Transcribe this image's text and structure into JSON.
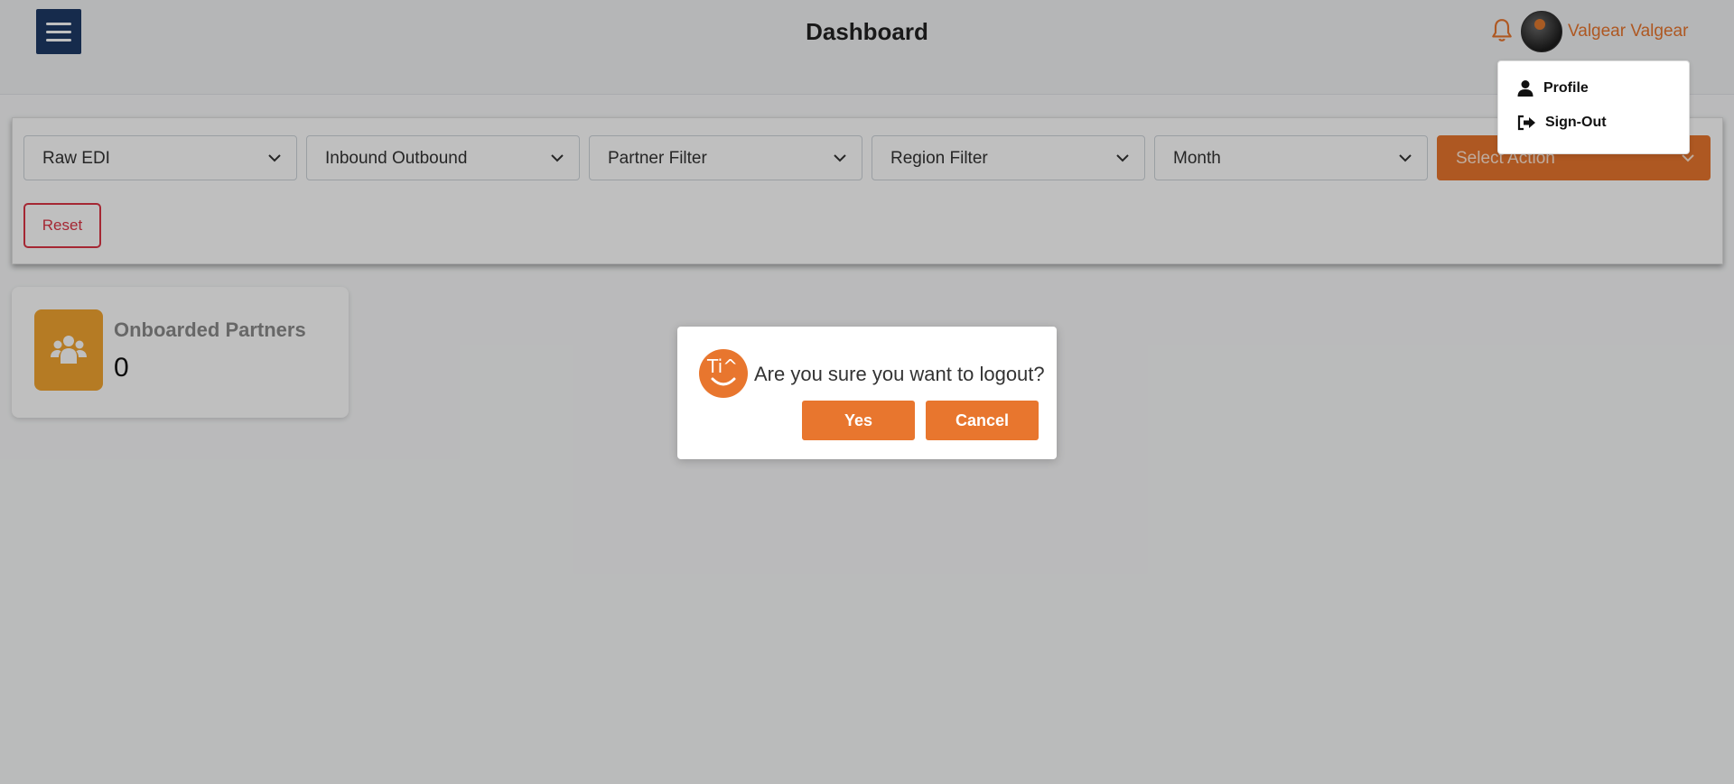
{
  "header": {
    "title": "Dashboard",
    "user_name": "Valgear Valgear"
  },
  "user_menu": {
    "items": [
      {
        "label": "Profile",
        "icon": "user-icon"
      },
      {
        "label": "Sign-Out",
        "icon": "sign-out-icon"
      }
    ]
  },
  "filters": {
    "raw_edi": "Raw EDI",
    "direction": "Inbound Outbound",
    "partner": "Partner Filter",
    "region": "Region Filter",
    "month": "Month",
    "action": "Select Action",
    "reset_label": "Reset"
  },
  "card": {
    "label": "Onboarded Partners",
    "value": "0",
    "icon": "users-icon"
  },
  "modal": {
    "message": "Are you sure you want to logout?",
    "yes_label": "Yes",
    "cancel_label": "Cancel",
    "logo_text": "Ti^"
  },
  "colors": {
    "accent": "#e8762e",
    "menu_button": "#1e3a66",
    "danger": "#dc3545",
    "card_icon_bg": "#f2a431"
  }
}
